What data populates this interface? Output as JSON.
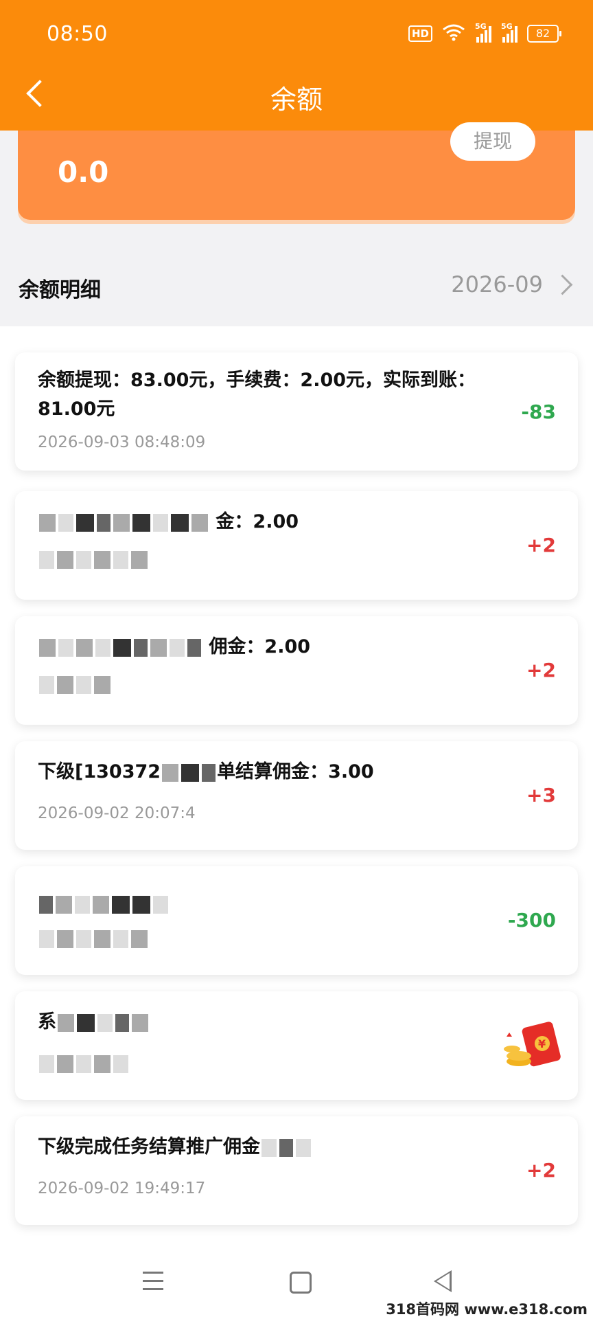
{
  "status_bar": {
    "time": "08:50",
    "battery": "82",
    "hd_label": "HD",
    "network_label": "5G"
  },
  "header": {
    "title": "余额"
  },
  "balance": {
    "value": "0.0",
    "withdraw_label": "提现"
  },
  "detail": {
    "title": "余额明细",
    "month": "2026-09"
  },
  "records": [
    {
      "title": "余额提现：83.00元，手续费：2.00元，实际到账：81.00元",
      "time": "2026-09-03 08:48:09",
      "amount": "-83",
      "type": "neg"
    },
    {
      "title": "金：2.00",
      "time": "",
      "amount": "+2",
      "type": "pos"
    },
    {
      "title": "佣金：2.00",
      "time": "",
      "amount": "+2",
      "type": "pos"
    },
    {
      "title_prefix": "下级[130372",
      "title_suffix": "单结算佣金：3.00",
      "time": "2026-09-02 20:07:4",
      "amount": "+3",
      "type": "pos"
    },
    {
      "title": "",
      "time": "",
      "amount": "-300",
      "type": "neg"
    },
    {
      "title": "系",
      "time": "",
      "amount": "",
      "type": "pos"
    },
    {
      "title": "下级完成任务结算推广佣金",
      "time": "2026-09-02 19:49:17",
      "amount": "+2",
      "type": "pos"
    }
  ],
  "watermark": "318首码网 www.e318.com"
}
